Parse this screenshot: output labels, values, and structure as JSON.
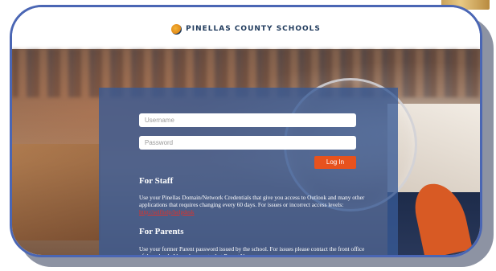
{
  "header": {
    "org_name": "PINELLAS COUNTY SCHOOLS",
    "logo_icon": "pinellas-logo-icon"
  },
  "login": {
    "username_placeholder": "Username",
    "password_placeholder": "Password",
    "submit_label": "Log In"
  },
  "staff": {
    "title": "For Staff",
    "body": "Use your Pinellas Domain/Network Credentials that give you access to Outlook and many other applications that requires changing every 60 days. For issues or incorrect access levels: ",
    "link_text": "http://selfhelp/helpdesk"
  },
  "parents": {
    "title": "For Parents",
    "body": "Use your former Parent password issued by the school. For issues please contact the front office of the school. Also, please note that Parent User"
  },
  "colors": {
    "panel": "#375a96",
    "button": "#e7521d",
    "frame_border": "#4a66b4",
    "link": "#e0322a"
  }
}
